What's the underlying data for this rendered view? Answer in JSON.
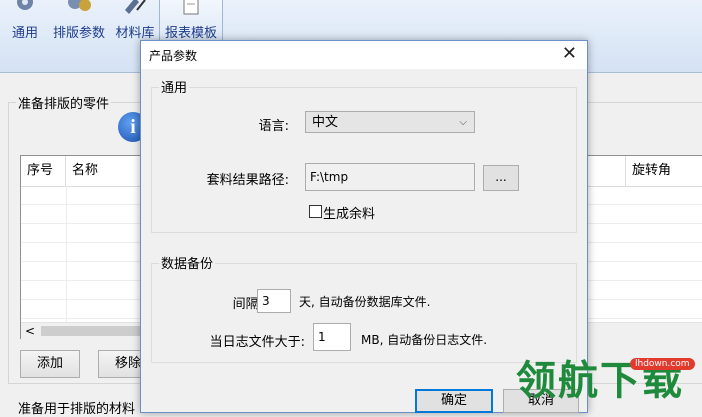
{
  "toolbar": {
    "items": [
      {
        "label": "通用",
        "icon": "gear-icon"
      },
      {
        "label": "排版参数",
        "icon": "settings-gears-icon"
      },
      {
        "label": "材料库",
        "icon": "materials-icon"
      },
      {
        "label": "报表模板",
        "icon": "report-template-icon"
      }
    ]
  },
  "main": {
    "parts_group_label": "准备排版的零件",
    "grid_headers": [
      "序号",
      "名称",
      "旋转角"
    ],
    "add_button": "添加",
    "remove_button": "移除",
    "materials_label": "准备用于排版的材料"
  },
  "dialog": {
    "title": "产品参数",
    "close_glyph": "✕",
    "general": {
      "legend": "通用",
      "language_label": "语言:",
      "language_value": "中文",
      "result_path_label": "套料结果路径:",
      "result_path_value": "F:\\tmp",
      "browse_label": "...",
      "generate_remnant_label": "生成余料",
      "generate_remnant_checked": false
    },
    "backup": {
      "legend": "数据备份",
      "interval_label": "间隔:",
      "interval_value": "3",
      "interval_suffix": "天, 自动备份数据库文件.",
      "log_size_label": "当日志文件大于:",
      "log_size_value": "1",
      "log_size_suffix": "MB, 自动备份日志文件."
    },
    "ok_button": "确定",
    "cancel_button": "取消"
  },
  "watermark": {
    "text": "领航下载",
    "site": "lhdown.com"
  },
  "colors": {
    "dialog_border": "#6b8fc9",
    "primary_button_border": "#0078d7",
    "toolbar_label": "#1e3c8c",
    "watermark_green": "#1f8a3c",
    "watermark_badge_red": "#e23b2e"
  }
}
